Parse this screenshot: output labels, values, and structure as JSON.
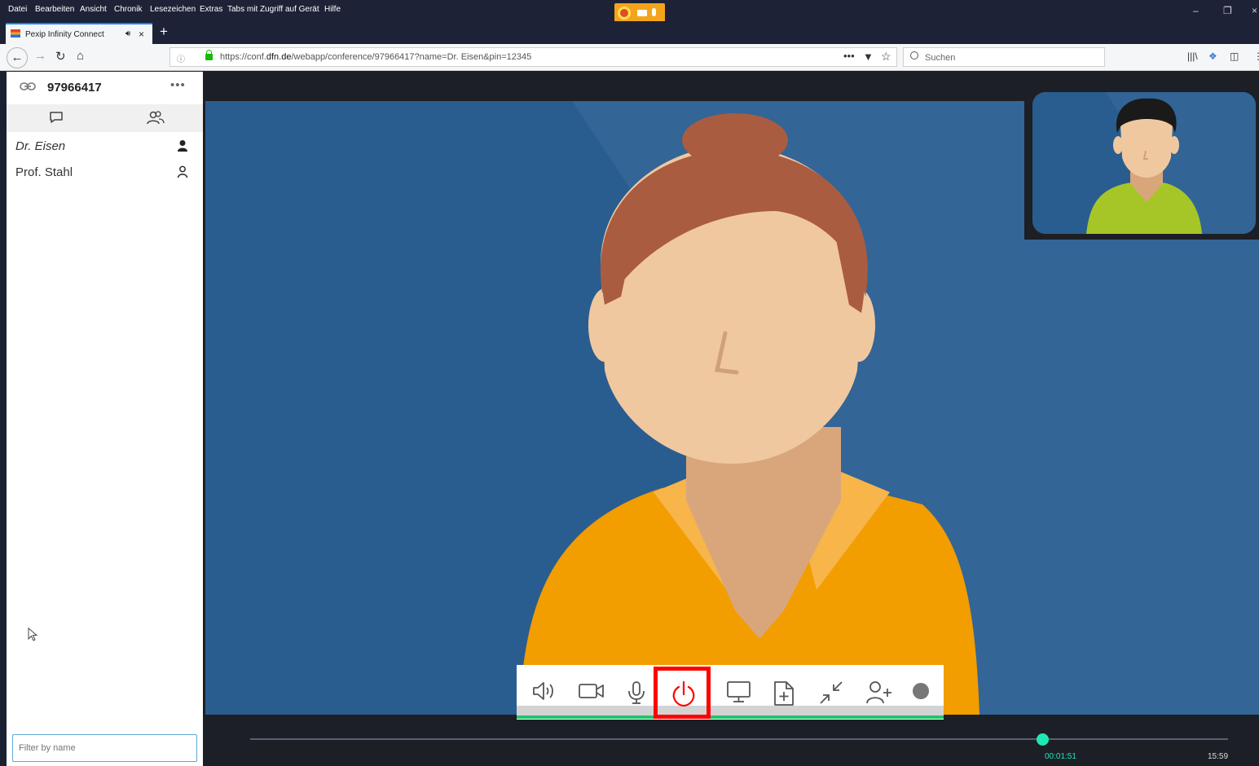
{
  "menubar": {
    "items": [
      "Datei",
      "Bearbeiten",
      "Ansicht",
      "Chronik",
      "Lesezeichen",
      "Extras",
      "Tabs mit Zugriff auf Gerät",
      "Hilfe"
    ]
  },
  "window_controls": {
    "minimize": "–",
    "restore": "❐",
    "close": "×"
  },
  "tab": {
    "title": "Pexip Infinity Connect",
    "close": "×",
    "new": "+"
  },
  "nav": {
    "url_prefix": "https://conf.",
    "url_domain": "dfn.de",
    "url_rest": "/webapp/conference/97966417?name=Dr. Eisen&pin=12345",
    "search_placeholder": "Suchen"
  },
  "sidebar": {
    "conference_id": "97966417",
    "more": "•••",
    "participants": [
      {
        "name": "Dr. Eisen",
        "italic": true
      },
      {
        "name": "Prof. Stahl",
        "italic": false
      }
    ],
    "filter_placeholder": "Filter by name"
  },
  "controls": {
    "buttons": [
      "speaker-icon",
      "camera-icon",
      "microphone-icon",
      "power-icon",
      "screen-share-icon",
      "add-file-icon",
      "minimize-arrows-icon",
      "add-user-icon",
      "record-dot-icon"
    ],
    "highlight": "#ff0000"
  },
  "timeline": {
    "current": "00:01:51",
    "total": "15:59",
    "progress": 0.81
  },
  "colors": {
    "background": "#2a5d8f",
    "accent_green": "#1ee8b8",
    "shirt": "#f29d00",
    "hair": "#a95c40",
    "skin": "#f0c8a0"
  }
}
